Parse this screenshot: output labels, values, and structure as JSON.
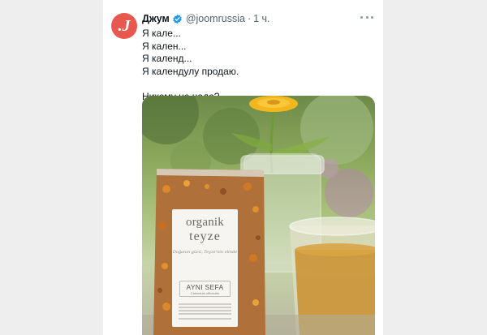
{
  "tweet": {
    "author_name": "Джум",
    "handle": "@joomrussia",
    "separator": "·",
    "time": "1 ч.",
    "avatar_glyph": ".J",
    "lines": [
      "Я кале...",
      "Я кален...",
      "Я календ...",
      "Я календулу продаю.",
      "",
      "Никому не надо?"
    ]
  },
  "media": {
    "label_brand_line1": "organik",
    "label_brand_line2": "teyze",
    "label_slogan": "Doğanın gücü, Teyze'nin elinde",
    "label_product": "AYNI SEFA",
    "label_product_sub": "Calendula officinalis"
  },
  "colors": {
    "avatar": "#e8584e",
    "verified": "#1d9bf0",
    "text": "#0f1419",
    "muted": "#536471"
  },
  "icons": {
    "verified": "verified-badge-icon",
    "more": "more-options-icon"
  }
}
